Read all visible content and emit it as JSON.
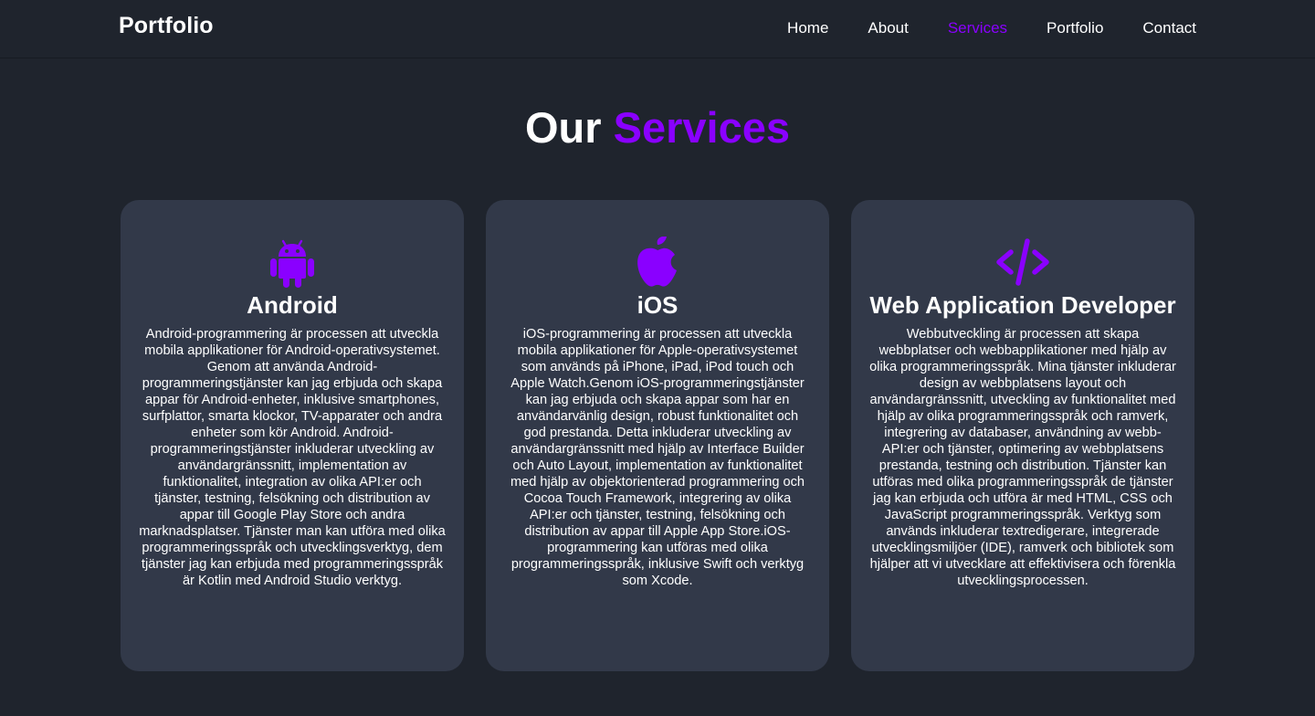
{
  "header": {
    "brand": "Portfolio",
    "nav": [
      {
        "label": "Home",
        "active": false
      },
      {
        "label": "About",
        "active": false
      },
      {
        "label": "Services",
        "active": true
      },
      {
        "label": "Portfolio",
        "active": false
      },
      {
        "label": "Contact",
        "active": false
      }
    ]
  },
  "section": {
    "title_prefix": "Our",
    "title_accent": "Services"
  },
  "colors": {
    "background": "#1f242d",
    "card": "#323949",
    "accent": "#8a00ff",
    "text": "#ffffff"
  },
  "services": [
    {
      "icon": "android-icon",
      "title": "Android",
      "description": "Android-programmering är processen att utveckla mobila applikationer för Android-operativsystemet. Genom att använda Android-programmeringstjänster kan jag erbjuda och skapa appar för Android-enheter, inklusive smartphones, surfplattor, smarta klockor, TV-apparater och andra enheter som kör Android. Android-programmeringstjänster inkluderar utveckling av användargränssnitt, implementation av funktionalitet, integration av olika API:er och tjänster, testning, felsökning och distribution av appar till Google Play Store och andra marknadsplatser. Tjänster man kan utföra med olika programmeringsspråk och utvecklingsverktyg, dem tjänster jag kan erbjuda med programmeringsspråk är Kotlin med Android Studio verktyg."
    },
    {
      "icon": "apple-icon",
      "title": "iOS",
      "description": "iOS-programmering är processen att utveckla mobila applikationer för Apple-operativsystemet som används på iPhone, iPad, iPod touch och Apple Watch.Genom iOS-programmeringstjänster kan jag erbjuda och skapa appar som har en användarvänlig design, robust funktionalitet och god prestanda. Detta inkluderar utveckling av användargränssnitt med hjälp av Interface Builder och Auto Layout, implementation av funktionalitet med hjälp av objektorienterad programmering och Cocoa Touch Framework, integrering av olika API:er och tjänster, testning, felsökning och distribution av appar till Apple App Store.iOS-programmering kan utföras med olika programmeringsspråk, inklusive Swift och verktyg som Xcode."
    },
    {
      "icon": "code-icon",
      "title": "Web Application Developer",
      "description": "Webbutveckling är processen att skapa webbplatser och webbapplikationer med hjälp av olika programmeringsspråk. Mina tjänster inkluderar design av webbplatsens layout och användargränssnitt, utveckling av funktionalitet med hjälp av olika programmeringsspråk och ramverk, integrering av databaser, användning av webb-API:er och tjänster, optimering av webbplatsens prestanda, testning och distribution. Tjänster kan utföras med olika programmeringsspråk de tjänster jag kan erbjuda och utföra är med HTML, CSS och JavaScript programmeringsspråk. Verktyg som används inkluderar textredigerare, integrerade utvecklingsmiljöer (IDE), ramverk och bibliotek som hjälper att vi utvecklare att effektivisera och förenkla utvecklingsprocessen."
    }
  ]
}
